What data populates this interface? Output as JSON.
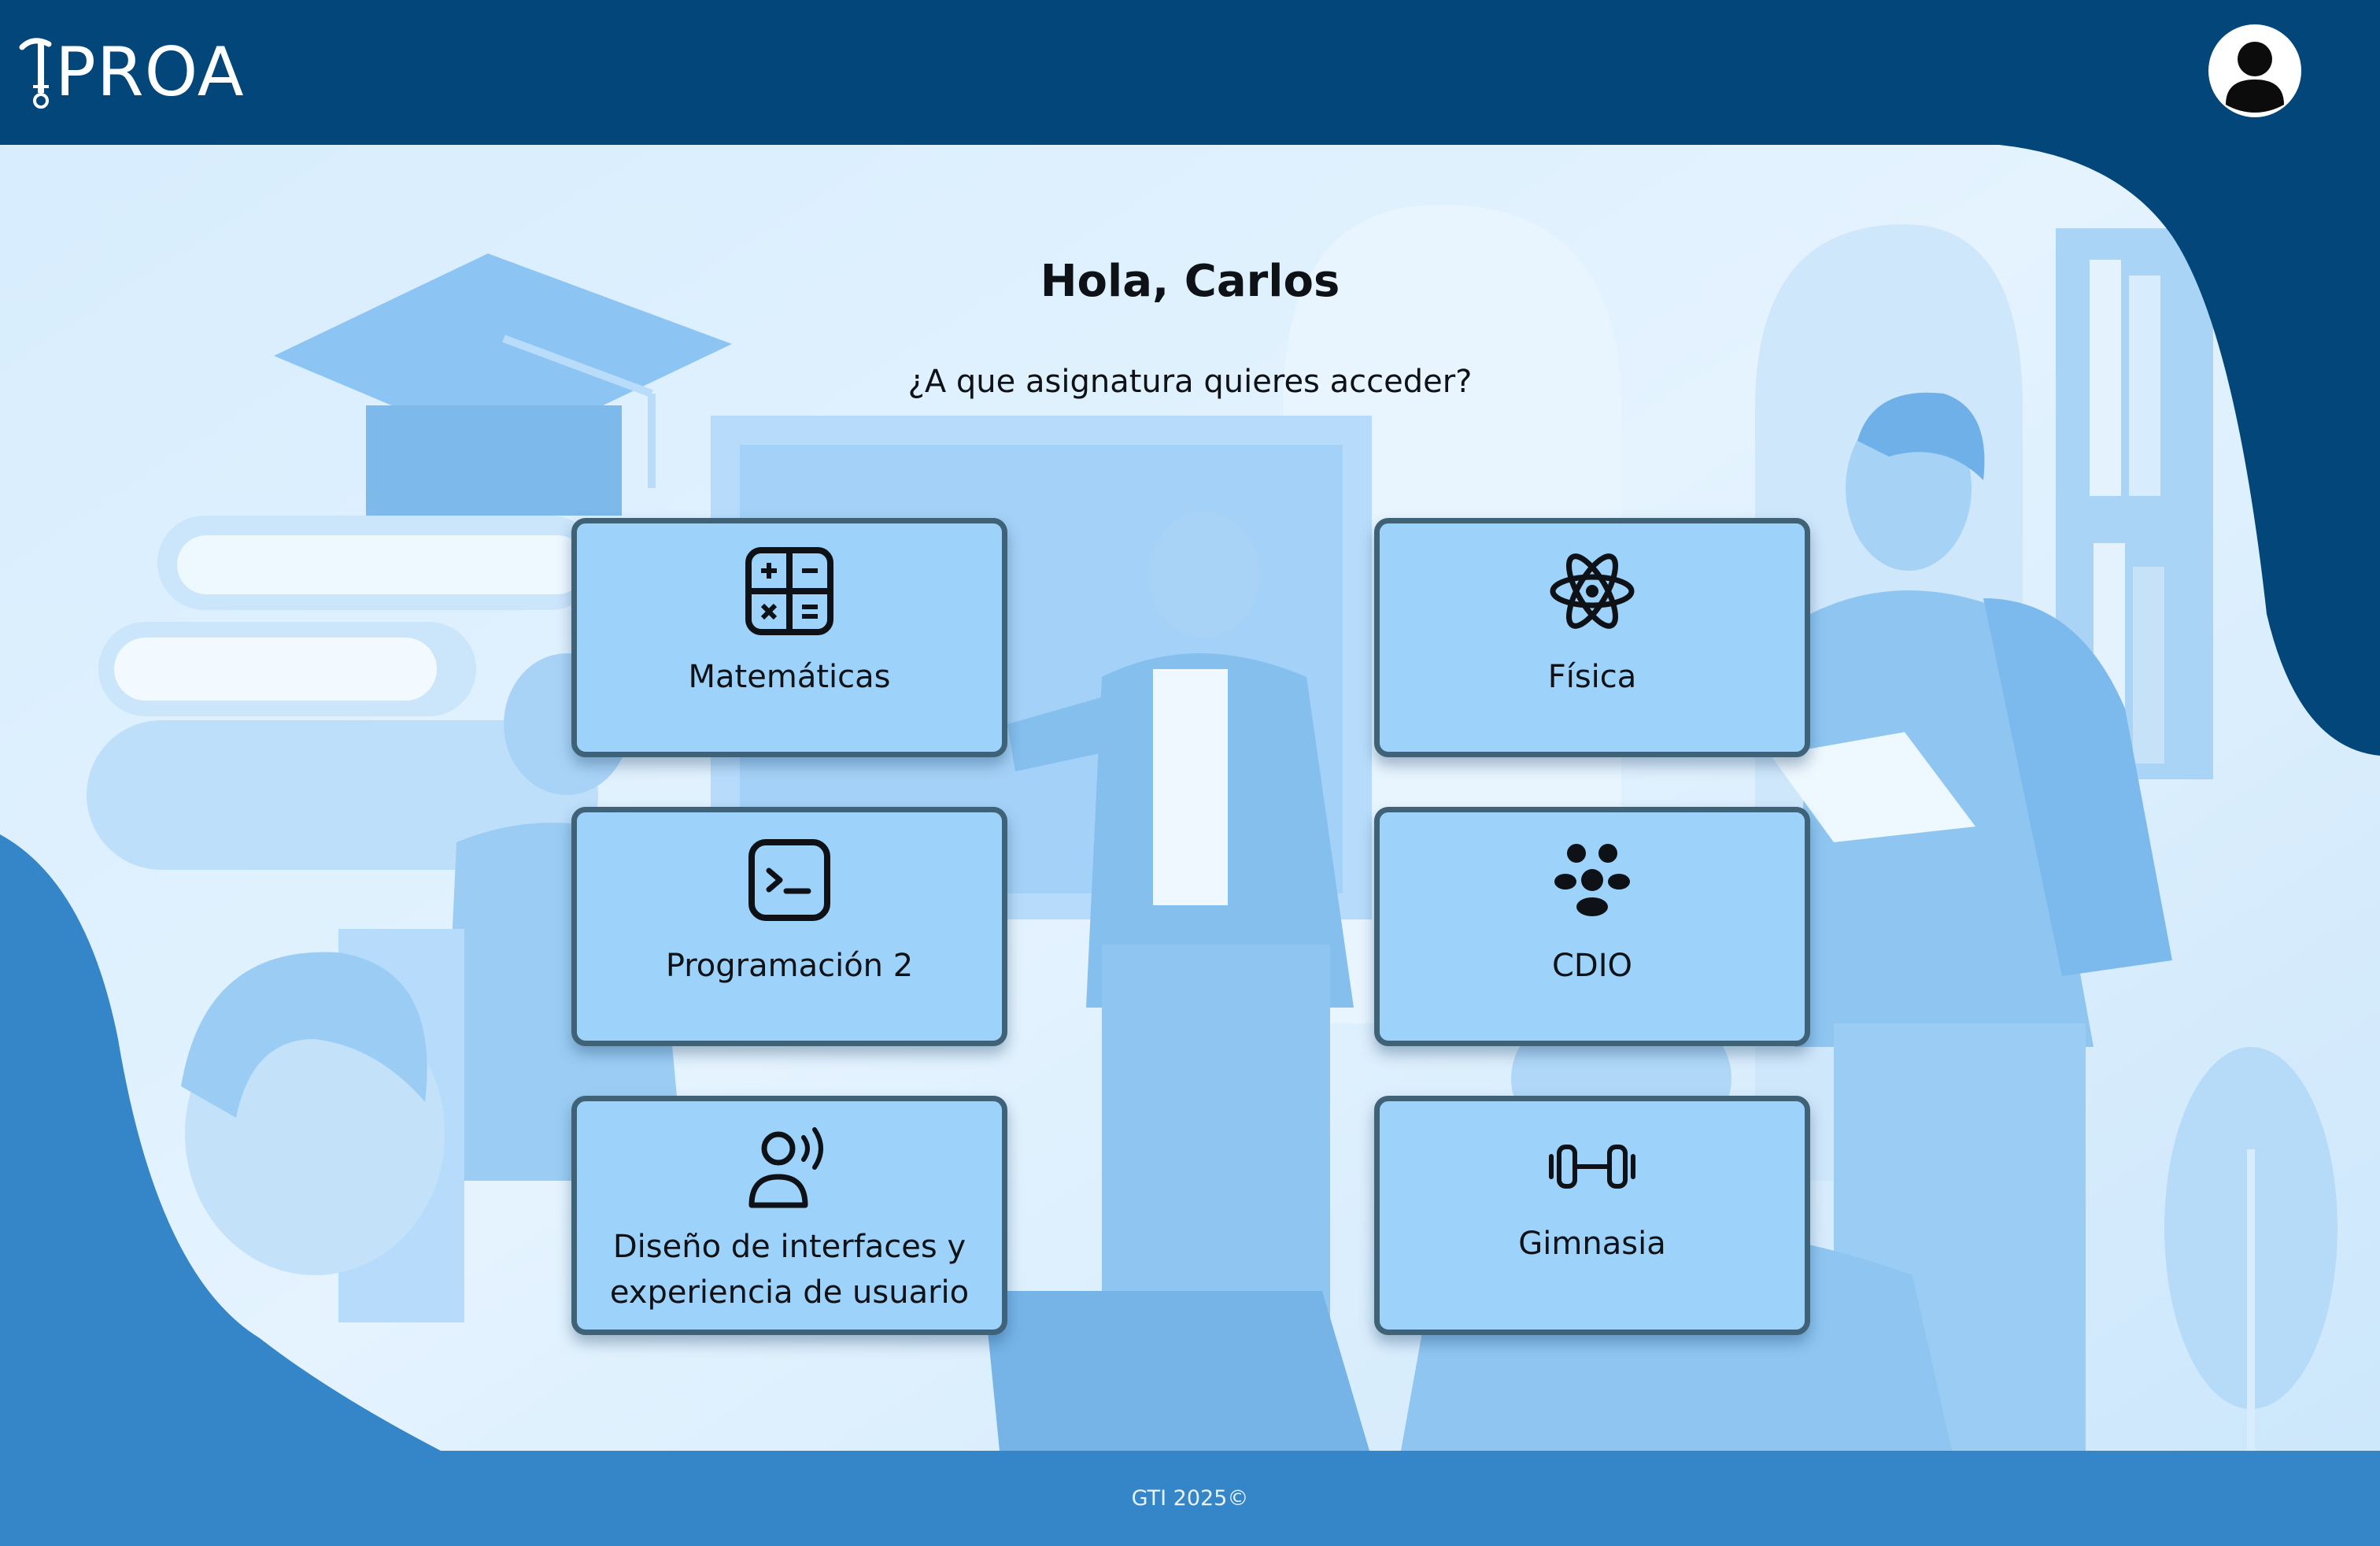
{
  "header": {
    "logo_text": "PROA",
    "avatar_icon": "user-avatar-icon"
  },
  "main": {
    "greeting": "Hola, Carlos",
    "question": "¿A que asignatura quieres acceder?",
    "subjects": [
      {
        "label": "Matemáticas",
        "icon": "calculator-icon"
      },
      {
        "label": "Física",
        "icon": "atom-icon"
      },
      {
        "label": "Programación 2",
        "icon": "terminal-icon"
      },
      {
        "label": "CDIO",
        "icon": "team-icon"
      },
      {
        "label": "Diseño de interfaces y experiencia de usuario",
        "icon": "user-voice-icon"
      },
      {
        "label": "Gimnasia",
        "icon": "dumbbell-icon"
      }
    ]
  },
  "footer": {
    "text": "GTI 2025©"
  },
  "colors": {
    "header_bg": "#02467a",
    "footer_bg": "#3486c8",
    "card_bg": "#9dd3fa",
    "card_border": "#3f6277",
    "scene_light": "#dcefff"
  }
}
